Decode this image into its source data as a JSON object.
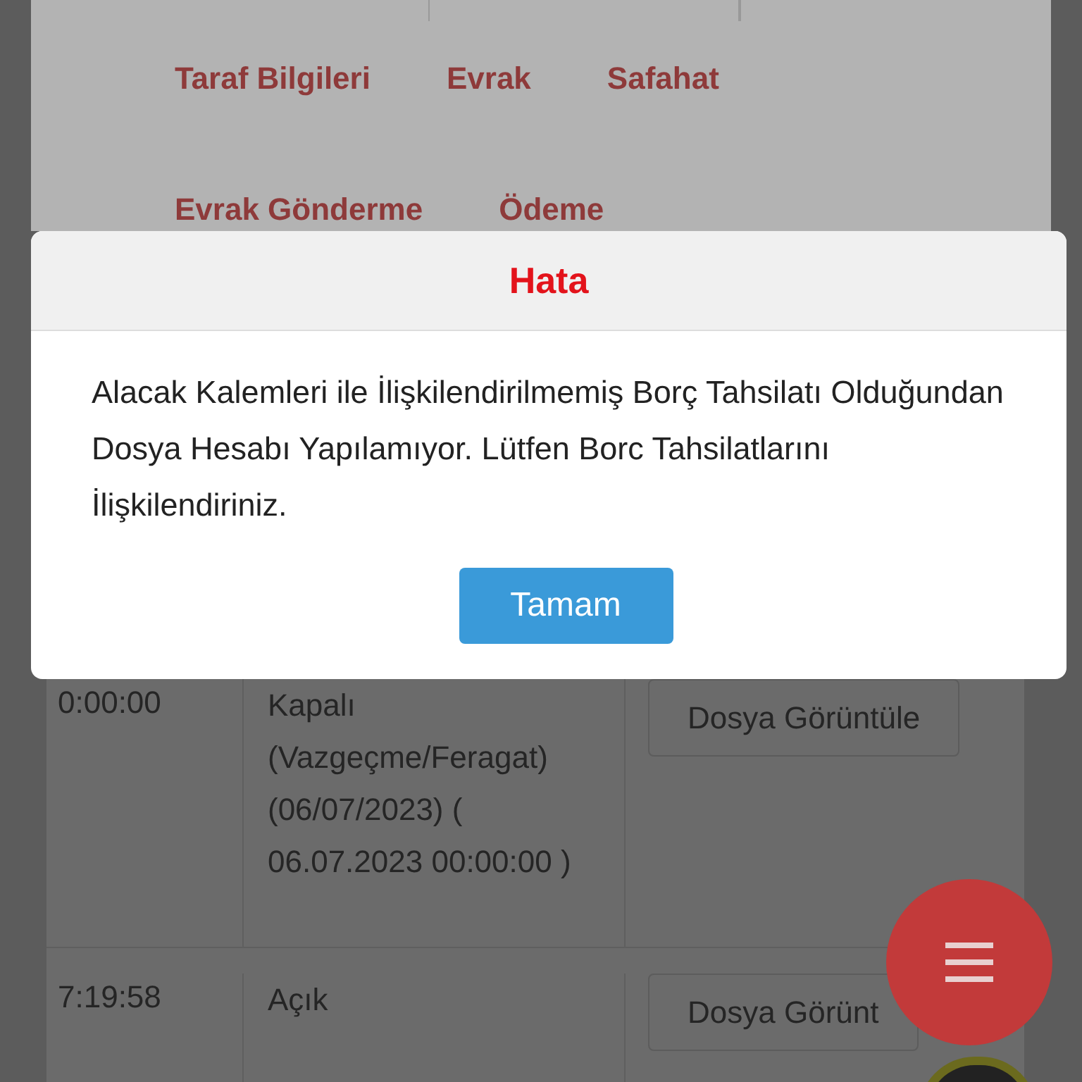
{
  "tabs": [
    {
      "label": "Taraf Bilgileri",
      "selected": false
    },
    {
      "label": "Evrak",
      "selected": false
    },
    {
      "label": "Safahat",
      "selected": false
    },
    {
      "label": "Evrak Gönderme",
      "selected": false
    },
    {
      "label": "Ödeme",
      "selected": false
    }
  ],
  "dialog": {
    "title": "Hata",
    "message": "Alacak Kalemleri ile İlişkilendirilmemiş Borç Tahsilatı Olduğundan Dosya Hesabı Yapılamıyor. Lütfen Borc Tahsilatlarını İlişkilendiriniz.",
    "button": "Tamam"
  },
  "table": {
    "rows": [
      {
        "column_1": "0:00:00",
        "column_2": "Kapalı (Vazgeçme/Feragat) (06/07/2023) ( 06.07.2023 00:00:00 )",
        "column_3": "Dosya Görüntüle"
      },
      {
        "column_1": "7:19:58",
        "column_2": "Açık",
        "column_3": "Dosya Görünt"
      }
    ]
  }
}
